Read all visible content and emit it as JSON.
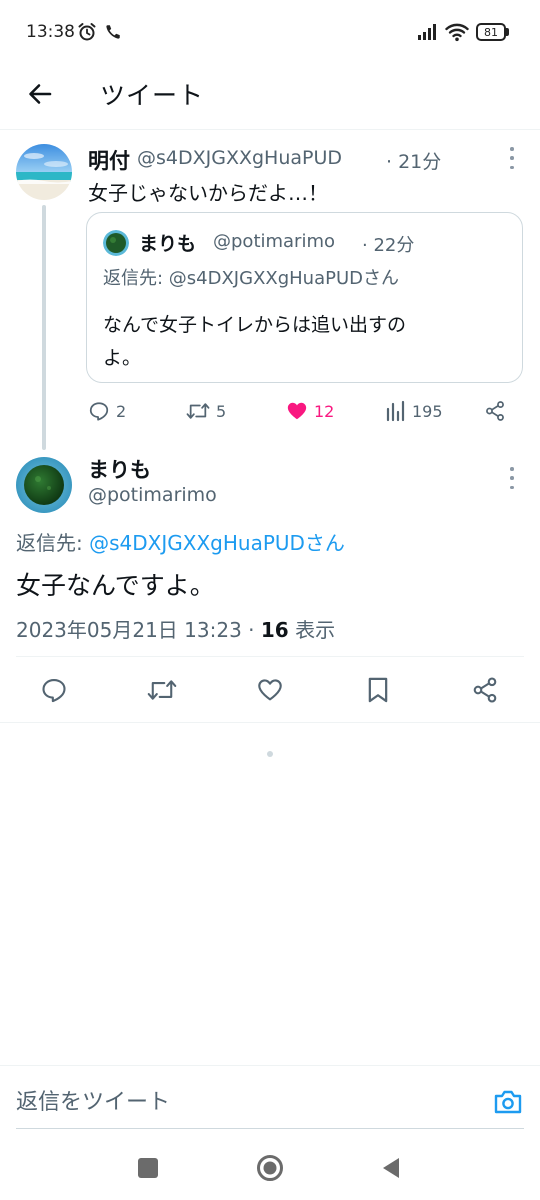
{
  "status_bar": {
    "time": "13:38",
    "battery": "81",
    "icons": [
      "alarm-icon",
      "phone-icon",
      "signal-icon",
      "wifi-icon",
      "battery-icon"
    ]
  },
  "header": {
    "title": "ツイート",
    "back_icon": "back-arrow-icon"
  },
  "parent_tweet": {
    "display_name": "明付",
    "handle": "@s4DXJGXXgHuaPUD",
    "time_ago": "· 21分",
    "text": "女子じゃないからだよ…！",
    "quote": {
      "display_name": "まりも",
      "handle": "@potimarimo",
      "time_ago": "· 22分",
      "reply_to": "返信先: @s4DXJGXXgHuaPUDさん",
      "text_line1": "なんで女子トイレからは追い出すの",
      "text_line2": "よ。"
    },
    "stats": {
      "replies": "2",
      "retweets": "5",
      "likes": "12",
      "views": "195"
    }
  },
  "main_tweet": {
    "display_name": "まりも",
    "handle": "@potimarimo",
    "reply_to_prefix": "返信先: ",
    "reply_to_handle": "@s4DXJGXXgHuaPUDさん",
    "text": "女子なんですよ。",
    "timestamp": "2023年05月21日 13:23 · ",
    "view_count": "16",
    "view_label": " 表示"
  },
  "reply_bar": {
    "placeholder": "返信をツイート",
    "camera_icon": "camera-icon"
  },
  "colors": {
    "accent": "#1d9bf0",
    "like": "#f91880",
    "secondary_text": "#536471",
    "border": "#cfd9de"
  },
  "nav_bar": {
    "icons": [
      "recents-square-icon",
      "home-circle-icon",
      "back-triangle-icon"
    ]
  }
}
